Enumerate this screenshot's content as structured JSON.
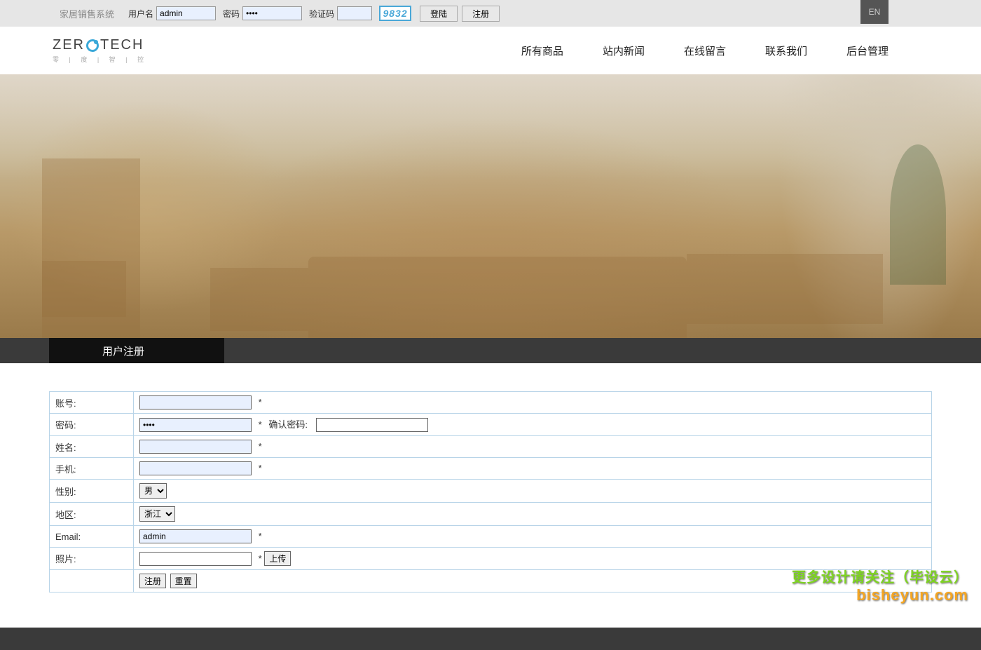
{
  "topbar": {
    "system_title": "家居销售系统",
    "username_label": "用户名",
    "username_value": "admin",
    "password_label": "密码",
    "password_value": "••••",
    "captcha_label": "验证码",
    "captcha_value": "",
    "captcha_code": "9832",
    "login_btn": "登陆",
    "register_btn": "注册",
    "lang": "EN"
  },
  "logo": {
    "main_left": "ZER",
    "main_right": "TECH",
    "sub": "零 | 度 | 智 | 控"
  },
  "nav": {
    "items": [
      "所有商品",
      "站内新闻",
      "在线留言",
      "联系我们",
      "后台管理"
    ]
  },
  "section": {
    "title": "用户注册"
  },
  "form": {
    "account_label": "账号:",
    "account_value": "",
    "password_label": "密码:",
    "password_value": "••••",
    "confirm_pwd_label": "确认密码:",
    "confirm_pwd_value": "",
    "name_label": "姓名:",
    "name_value": "",
    "phone_label": "手机:",
    "phone_value": "",
    "gender_label": "性别:",
    "gender_selected": "男",
    "region_label": "地区:",
    "region_selected": "浙江",
    "email_label": "Email:",
    "email_value": "admin",
    "photo_label": "照片:",
    "photo_value": "",
    "upload_btn": "上传",
    "submit_btn": "注册",
    "reset_btn": "重置",
    "required_mark": "*"
  },
  "watermark": {
    "line1": "更多设计请关注（毕设云）",
    "line2": "bisheyun.com"
  }
}
